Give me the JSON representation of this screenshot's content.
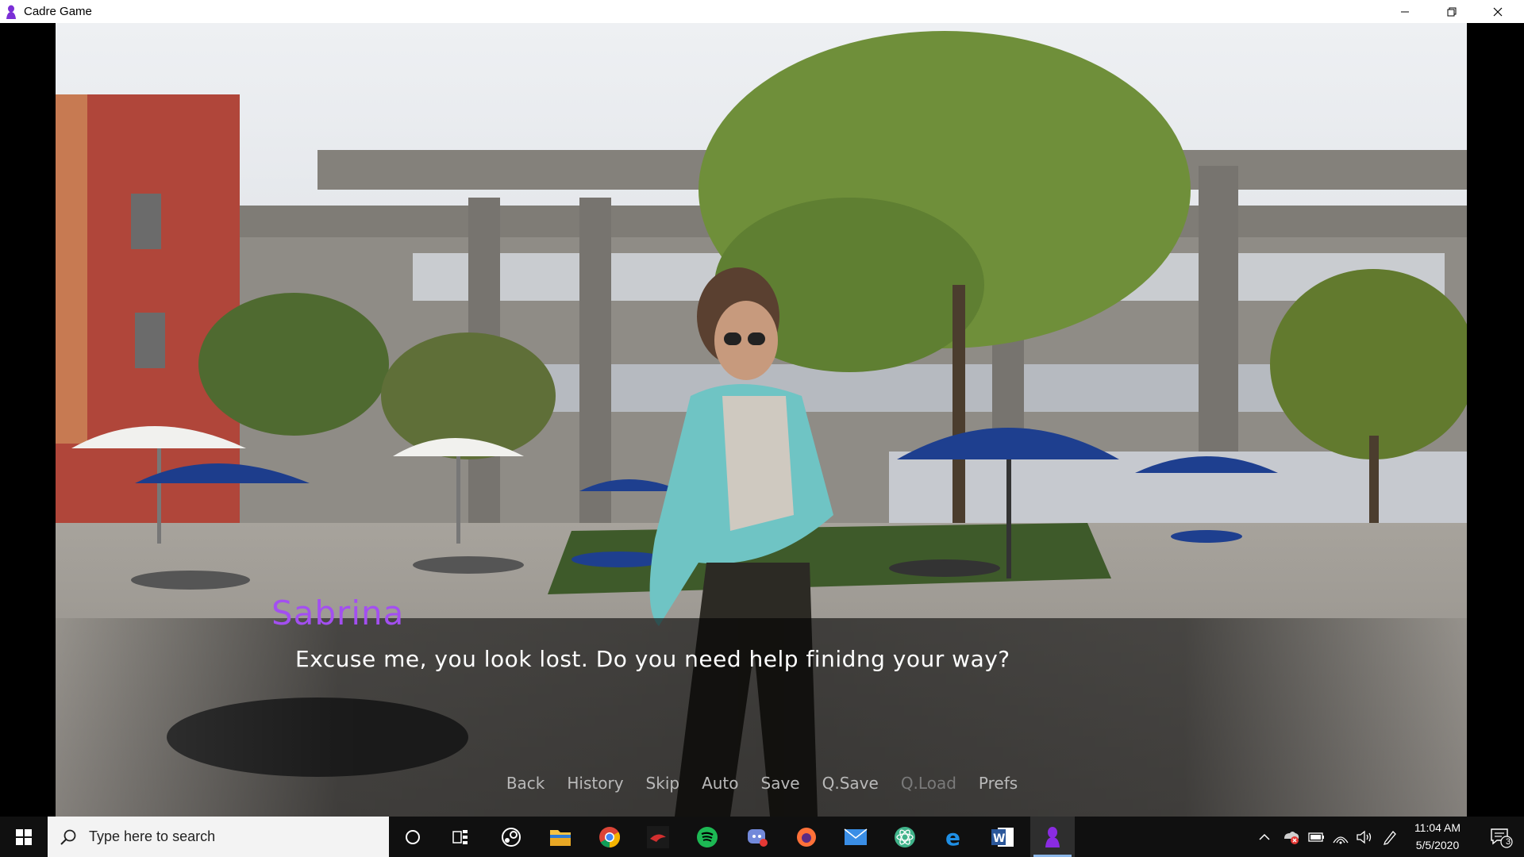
{
  "window": {
    "title": "Cadre Game"
  },
  "dialogue": {
    "speaker": "Sabrina",
    "text": "Excuse me, you look lost. Do you need help finidng your way?",
    "speaker_color": "#a34ff0"
  },
  "quick_menu": {
    "back": "Back",
    "history": "History",
    "skip": "Skip",
    "auto": "Auto",
    "save": "Save",
    "qsave": "Q.Save",
    "qload": "Q.Load",
    "prefs": "Prefs"
  },
  "taskbar": {
    "search_placeholder": "Type here to search",
    "pinned_icons": [
      "cortana-icon",
      "task-view-icon",
      "steam-icon",
      "file-explorer-icon",
      "chrome-icon",
      "game-app-icon",
      "spotify-icon",
      "discord-icon",
      "firefox-icon",
      "mail-icon",
      "atom-icon",
      "edge-icon",
      "word-icon",
      "cadre-game-icon"
    ],
    "tray_icons": [
      "show-hidden-icons-chevron",
      "dropbox-icon",
      "battery-icon",
      "wifi-icon",
      "volume-icon",
      "pen-icon"
    ],
    "time": "11:04 AM",
    "date": "5/5/2020",
    "notification_count": "3"
  }
}
